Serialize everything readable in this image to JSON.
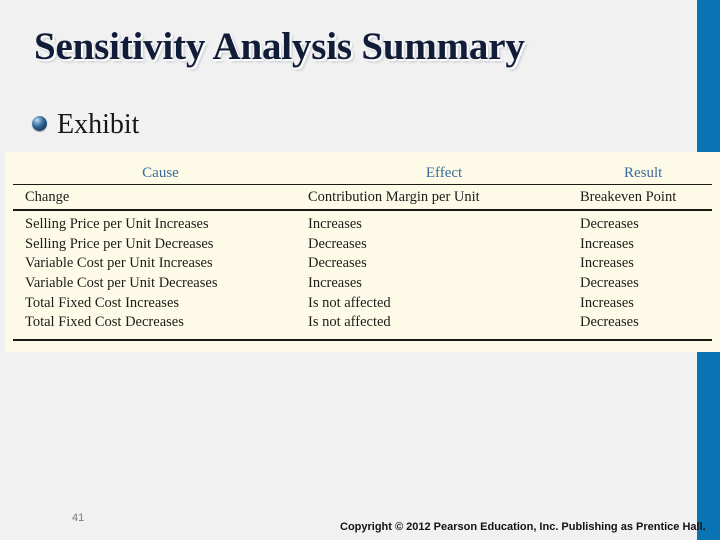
{
  "slide": {
    "title": "Sensitivity Analysis Summary",
    "bullet": {
      "icon": "sphere-bullet-icon",
      "label": "Exhibit"
    },
    "background_color": "#f1f1f1",
    "accent_color": "#0a74b4"
  },
  "exhibit": {
    "background_color": "#fdfbe8",
    "header_color": "#3b6a9c",
    "columns": [
      {
        "heading": "Cause",
        "subheading": "Change"
      },
      {
        "heading": "Effect",
        "subheading": "Contribution Margin per Unit"
      },
      {
        "heading": "Result",
        "subheading": "Breakeven Point"
      }
    ],
    "rows": [
      {
        "cause": "Selling Price per Unit Increases",
        "effect": "Increases",
        "result": "Decreases"
      },
      {
        "cause": "Selling Price per Unit Decreases",
        "effect": "Decreases",
        "result": "Increases"
      },
      {
        "cause": "Variable Cost per Unit Increases",
        "effect": "Decreases",
        "result": "Increases"
      },
      {
        "cause": "Variable Cost per Unit Decreases",
        "effect": "Increases",
        "result": "Decreases"
      },
      {
        "cause": "Total Fixed Cost Increases",
        "effect": "Is not affected",
        "result": "Increases"
      },
      {
        "cause": "Total Fixed Cost Decreases",
        "effect": "Is not affected",
        "result": "Decreases"
      }
    ]
  },
  "footer": {
    "page_number": "41",
    "copyright": "Copyright © 2012 Pearson Education, Inc. Publishing as Prentice Hall."
  }
}
